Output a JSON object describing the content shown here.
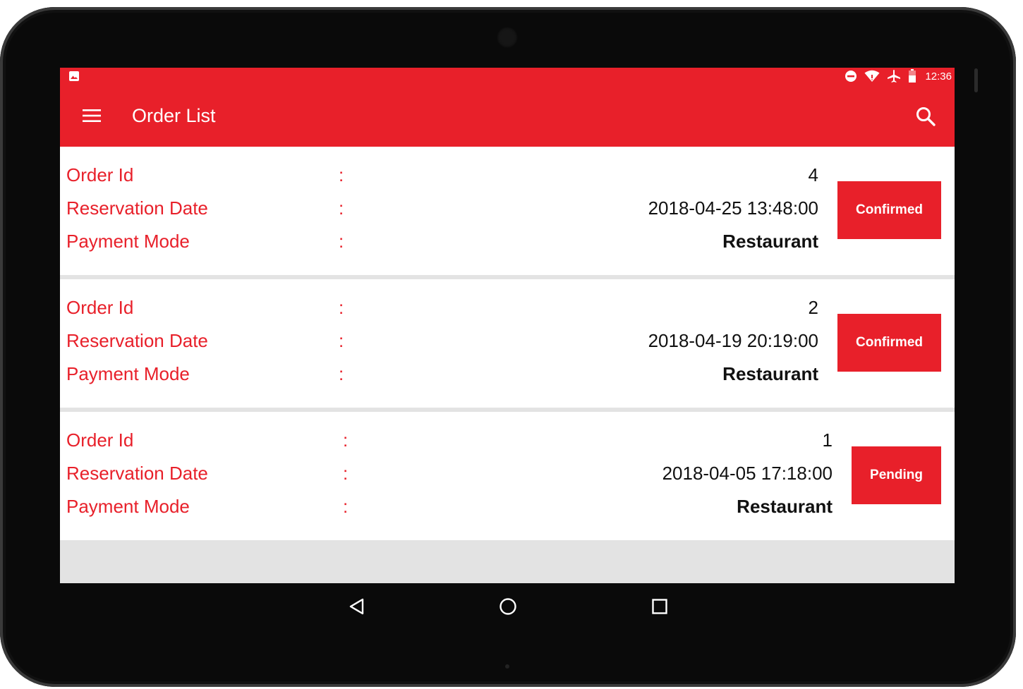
{
  "status_bar": {
    "time": "12:36",
    "left_icon": "image-notification-icon",
    "right_icons": [
      "do-not-disturb-icon",
      "wifi-icon",
      "airplane-icon",
      "battery-icon"
    ]
  },
  "app_bar": {
    "title": "Order List",
    "menu_icon": "menu-icon",
    "search_icon": "search-icon"
  },
  "labels": {
    "order_id": "Order Id",
    "reservation_date": "Reservation Date",
    "payment_mode": "Payment Mode",
    "separator": ":"
  },
  "orders": [
    {
      "order_id": "4",
      "reservation_date": "2018-04-25 13:48:00",
      "payment_mode": "Restaurant",
      "status": "Confirmed"
    },
    {
      "order_id": "2",
      "reservation_date": "2018-04-19 20:19:00",
      "payment_mode": "Restaurant",
      "status": "Confirmed"
    },
    {
      "order_id": "1",
      "reservation_date": "2018-04-05 17:18:00",
      "payment_mode": "Restaurant",
      "status": "Pending"
    }
  ],
  "nav_bar": {
    "icons": [
      "back-icon",
      "home-icon",
      "recents-icon"
    ]
  },
  "colors": {
    "accent": "#e8202a",
    "background": "#e3e3e3",
    "card": "#ffffff"
  }
}
